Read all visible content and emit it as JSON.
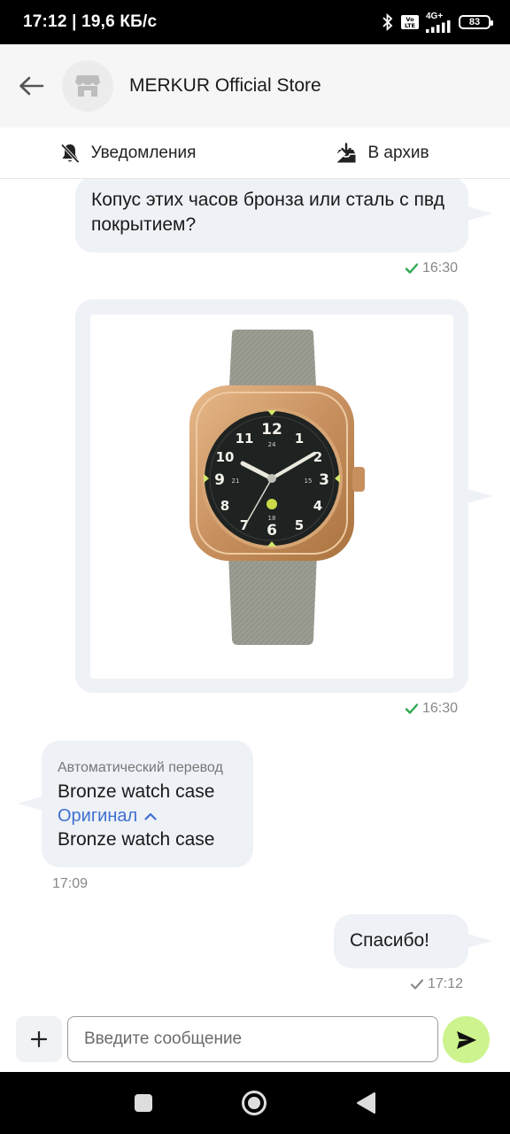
{
  "status_bar": {
    "time": "17:12 | 19,6 КБ/с",
    "volte": "Vo LTE",
    "network": "4G+",
    "battery": "83"
  },
  "header": {
    "store_name": "MERKUR Official Store",
    "back_icon": "arrow-left-icon",
    "avatar_icon": "store-icon"
  },
  "actions": {
    "notifications_label": "Уведомления",
    "notifications_icon": "bell-off-icon",
    "archive_label": "В архив",
    "archive_icon": "archive-icon"
  },
  "messages": {
    "m1": {
      "text": "Копус этих часов бронза или сталь с пвд покрытием?",
      "time": "16:30",
      "status": "read"
    },
    "m2": {
      "time": "16:30",
      "status": "read",
      "image": "bronze-watch-photo"
    },
    "m3": {
      "auto_label": "Автоматический перевод",
      "translated": "Bronze watch case",
      "original_link": "Оригинал",
      "original": "Bronze watch case",
      "time": "17:09"
    },
    "m4": {
      "text": "Спасибо!",
      "time": "17:12",
      "status": "sent"
    }
  },
  "composer": {
    "placeholder": "Введите сообщение"
  },
  "colors": {
    "bubble": "#eef1f6",
    "send_button": "#cdf38e",
    "link": "#3e6fd1",
    "check_read": "#2fa84f",
    "check_sent": "#8a8a8a"
  }
}
